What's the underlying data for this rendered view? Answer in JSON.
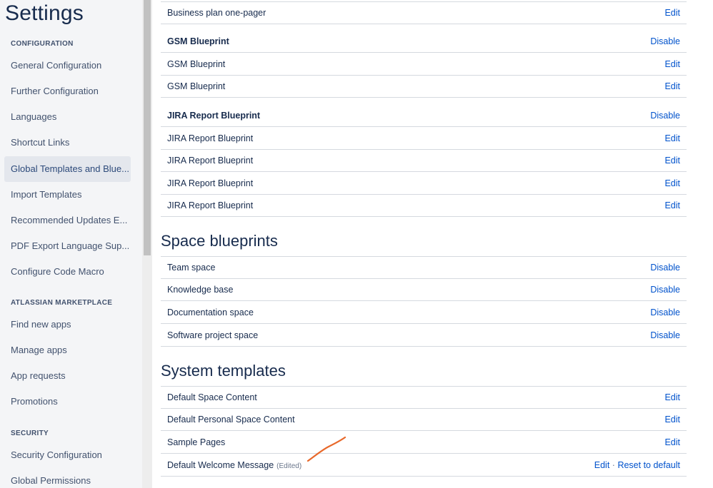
{
  "sidebar": {
    "title": "Settings",
    "sections": {
      "configuration": "CONFIGURATION",
      "marketplace": "ATLASSIAN MARKETPLACE",
      "security": "SECURITY"
    },
    "config_items": [
      "General Configuration",
      "Further Configuration",
      "Languages",
      "Shortcut Links",
      "Global Templates and Blue...",
      "Import Templates",
      "Recommended Updates E...",
      "PDF Export Language Sup...",
      "Configure Code Macro"
    ],
    "marketplace_items": [
      "Find new apps",
      "Manage apps",
      "App requests",
      "Promotions"
    ],
    "security_items": [
      "Security Configuration",
      "Global Permissions"
    ]
  },
  "main": {
    "top_rows": [
      {
        "label": "Business plan one-pager",
        "action": "Edit"
      }
    ],
    "gsm": {
      "header": {
        "label": "GSM Blueprint",
        "action": "Disable"
      },
      "rows": [
        {
          "label": "GSM Blueprint",
          "action": "Edit"
        },
        {
          "label": "GSM Blueprint",
          "action": "Edit"
        }
      ]
    },
    "jira": {
      "header": {
        "label": "JIRA Report Blueprint",
        "action": "Disable"
      },
      "rows": [
        {
          "label": "JIRA Report Blueprint",
          "action": "Edit"
        },
        {
          "label": "JIRA Report Blueprint",
          "action": "Edit"
        },
        {
          "label": "JIRA Report Blueprint",
          "action": "Edit"
        },
        {
          "label": "JIRA Report Blueprint",
          "action": "Edit"
        }
      ]
    },
    "space_blueprints": {
      "title": "Space blueprints",
      "rows": [
        {
          "label": "Team space",
          "action": "Disable"
        },
        {
          "label": "Knowledge base",
          "action": "Disable"
        },
        {
          "label": "Documentation space",
          "action": "Disable"
        },
        {
          "label": "Software project space",
          "action": "Disable"
        }
      ]
    },
    "system_templates": {
      "title": "System templates",
      "rows": [
        {
          "label": "Default Space Content",
          "action": "Edit"
        },
        {
          "label": "Default Personal Space Content",
          "action": "Edit"
        },
        {
          "label": "Sample Pages",
          "action": "Edit"
        }
      ],
      "welcome": {
        "label": "Default Welcome Message",
        "edited": "(Edited)",
        "edit": "Edit",
        "separator": "·",
        "reset": "Reset to default"
      }
    }
  },
  "colors": {
    "link": "#0052cc",
    "annotation": "#e8682a",
    "sidebar_bg": "#f4f5f7"
  }
}
